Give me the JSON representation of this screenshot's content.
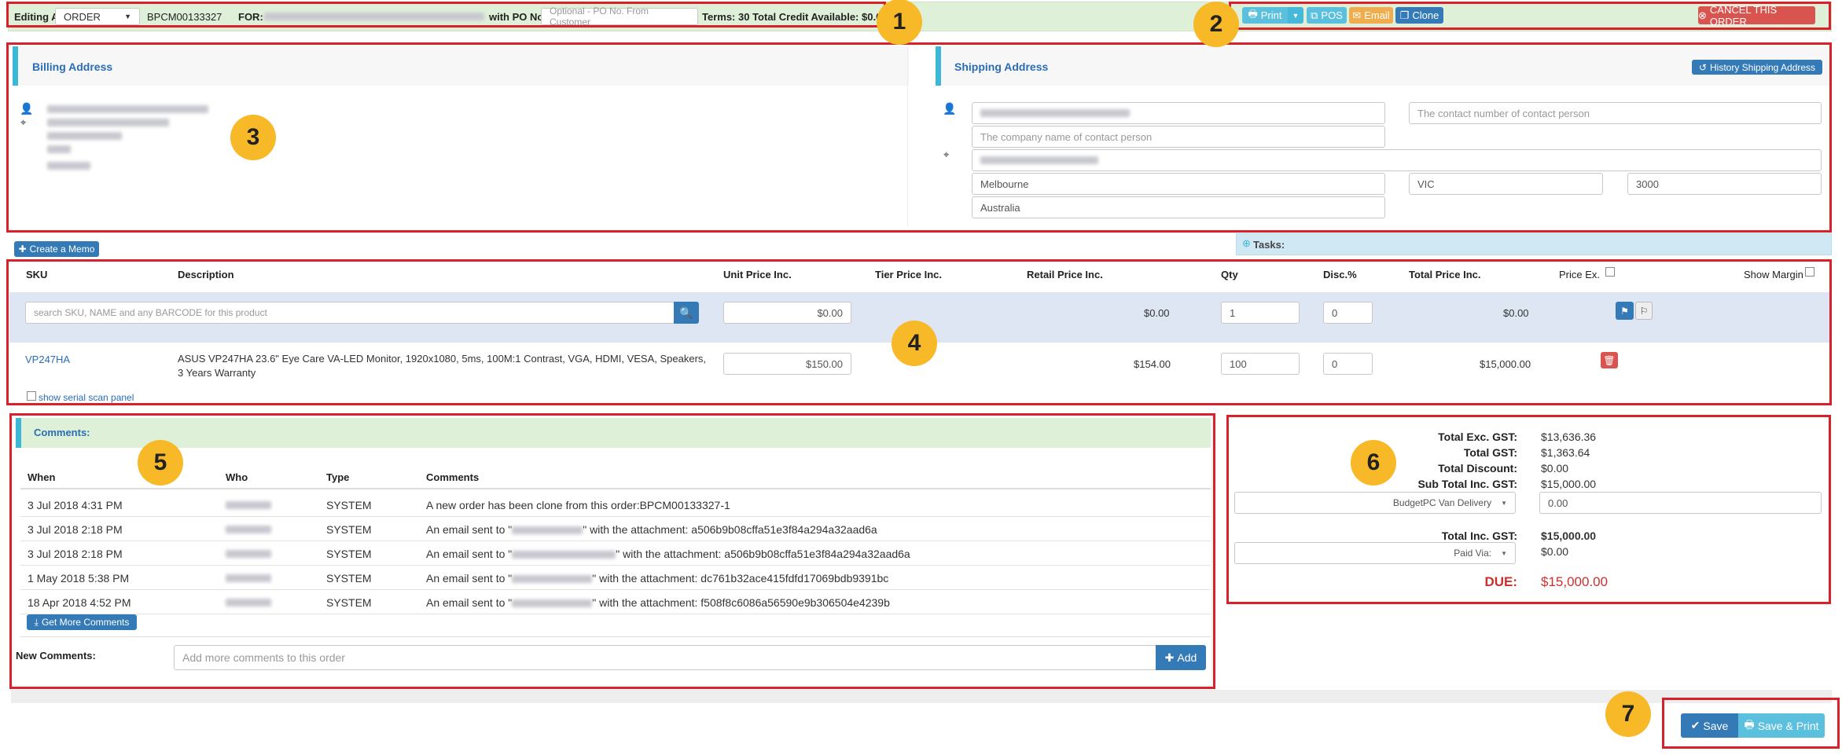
{
  "topbar": {
    "editing_label": "Editing A",
    "doc_type": "ORDER",
    "order_no": "BPCM00133327",
    "for_label": "FOR:",
    "po_label": "with PO No.:",
    "po_placeholder": "Optional - PO No. From Customer",
    "terms": "Terms: 30 Total Credit Available: $0.00",
    "print": "Print",
    "pos": "POS",
    "email": "Email",
    "clone": "Clone",
    "cancel": "CANCEL THIS ORDER"
  },
  "billing": {
    "title": "Billing Address"
  },
  "shipping": {
    "title": "Shipping Address",
    "history_button": "History Shipping Address",
    "contact_placeholder": "The contact number of contact person",
    "company_placeholder": "The company name of contact person",
    "city": "Melbourne",
    "state": "VIC",
    "postcode": "3000",
    "country": "Australia"
  },
  "memo_button": "Create a Memo",
  "tasks_label": "Tasks:",
  "items": {
    "headers": {
      "sku": "SKU",
      "description": "Description",
      "unit_price": "Unit Price Inc.",
      "tier_price": "Tier Price Inc.",
      "retail_price": "Retail Price Inc.",
      "qty": "Qty",
      "disc": "Disc.%",
      "total_price": "Total Price Inc.",
      "price_ex": "Price Ex.",
      "show_margin": "Show Margin"
    },
    "search_placeholder": "search SKU, NAME and any BARCODE for this product",
    "new_row": {
      "unit_price": "$0.00",
      "retail": "$0.00",
      "qty": "1",
      "disc": "0",
      "total": "$0.00"
    },
    "line": {
      "sku": "VP247HA",
      "description": "ASUS VP247HA 23.6\" Eye Care VA-LED Monitor, 1920x1080, 5ms, 100M:1 Contrast, VGA, HDMI, VESA, Speakers, 3 Years Warranty",
      "unit_price": "$150.00",
      "retail": "$154.00",
      "qty": "100",
      "disc": "0",
      "total": "$15,000.00"
    },
    "serial_label": "show serial scan panel"
  },
  "comments": {
    "title": "Comments:",
    "headers": {
      "when": "When",
      "who": "Who",
      "type": "Type",
      "comments": "Comments"
    },
    "rows": [
      {
        "when": "3 Jul 2018 4:31 PM",
        "type": "SYSTEM",
        "pre": "A new order has been clone from this order:BPCM00133327-1",
        "post": ""
      },
      {
        "when": "3 Jul 2018 2:18 PM",
        "type": "SYSTEM",
        "pre": "An email sent to \"",
        "post": "\" with the attachment: a506b9b08cffa51e3f84a294a32aad6a"
      },
      {
        "when": "3 Jul 2018 2:18 PM",
        "type": "SYSTEM",
        "pre": "An email sent to \"",
        "post": "\" with the attachment: a506b9b08cffa51e3f84a294a32aad6a"
      },
      {
        "when": "1 May 2018 5:38 PM",
        "type": "SYSTEM",
        "pre": "An email sent to \"",
        "post": "\" with the attachment: dc761b32ace415fdfd17069bdb9391bc"
      },
      {
        "when": "18 Apr 2018 4:52 PM",
        "type": "SYSTEM",
        "pre": "An email sent to \"",
        "post": "\" with the attachment: f508f8c6086a56590e9b306504e4239b"
      }
    ],
    "more_button": "Get More Comments",
    "new_label": "New Comments:",
    "new_placeholder": "Add more comments to this order",
    "add_button": "Add"
  },
  "summary": {
    "total_ex_label": "Total Exc. GST:",
    "total_ex": "$13,636.36",
    "gst_label": "Total GST:",
    "gst": "$1,363.64",
    "discount_label": "Total Discount:",
    "discount": "$0.00",
    "subtotal_label": "Sub Total Inc. GST:",
    "subtotal": "$15,000.00",
    "delivery_option": "BudgetPC Van Delivery",
    "delivery_cost": "0.00",
    "total_inc_label": "Total Inc. GST:",
    "total_inc": "$15,000.00",
    "paid_via_option": "Paid Via:",
    "paid": "$0.00",
    "due_label": "DUE:",
    "due": "$15,000.00"
  },
  "footer": {
    "save": "Save",
    "save_print": "Save & Print"
  },
  "badges": [
    "1",
    "2",
    "3",
    "4",
    "5",
    "6",
    "7"
  ]
}
